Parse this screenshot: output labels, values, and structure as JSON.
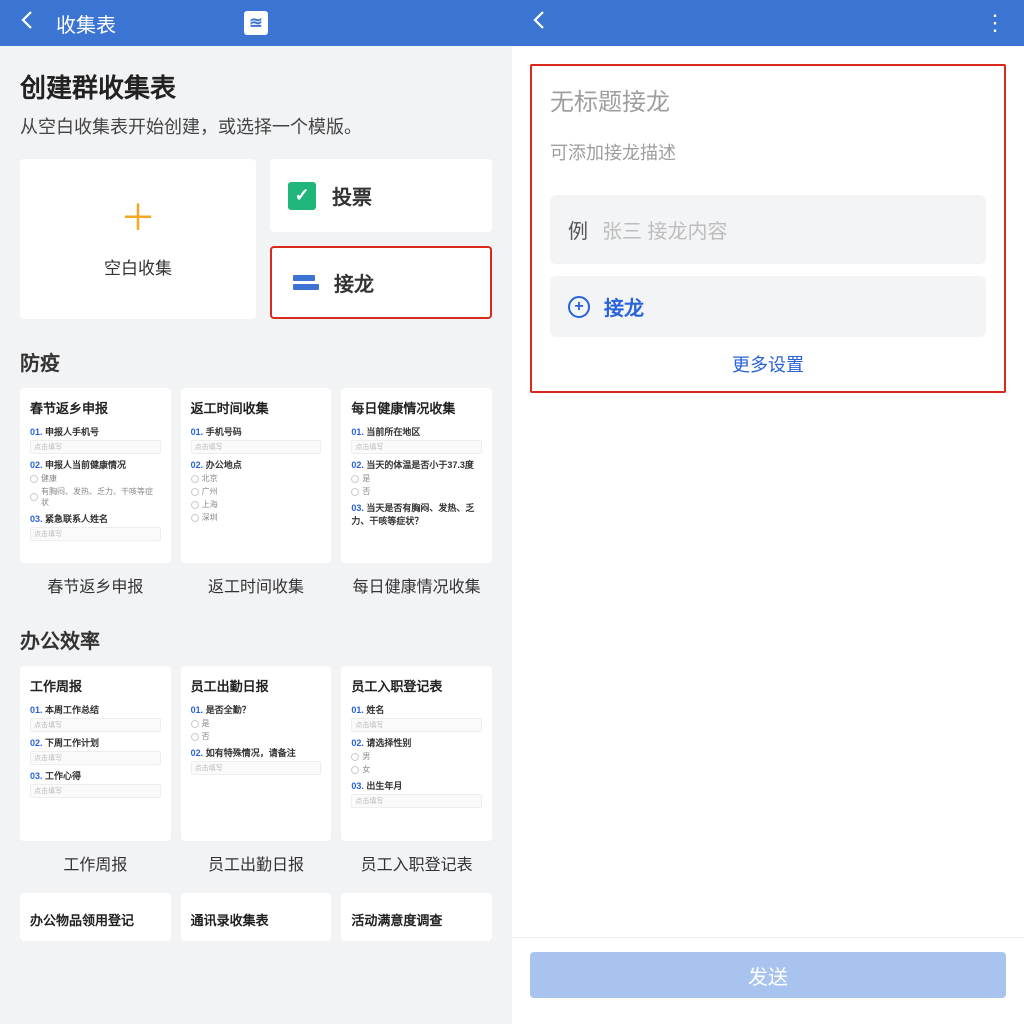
{
  "left": {
    "title": "收集表",
    "heading": "创建群收集表",
    "subheading": "从空白收集表开始创建，或选择一个模版。",
    "blank_label": "空白收集",
    "quick": {
      "vote": "投票",
      "chain": "接龙"
    },
    "sections": {
      "a_title": "防疫",
      "a": [
        {
          "name": "春节返乡申报",
          "fields": [
            {
              "n": "01.",
              "t": "申报人手机号",
              "input": true,
              "ph": "点击填写"
            },
            {
              "n": "02.",
              "t": "申报人当前健康情况",
              "opts": [
                "健康",
                "有胸闷、发热、乏力、干咳等症状"
              ]
            },
            {
              "n": "03.",
              "t": "紧急联系人姓名",
              "input": true,
              "ph": "点击填写"
            }
          ]
        },
        {
          "name": "返工时间收集",
          "fields": [
            {
              "n": "01.",
              "t": "手机号码",
              "input": true,
              "ph": "点击填写"
            },
            {
              "n": "02.",
              "t": "办公地点",
              "opts": [
                "北京",
                "广州",
                "上海",
                "深圳"
              ]
            }
          ]
        },
        {
          "name": "每日健康情况收集",
          "fields": [
            {
              "n": "01.",
              "t": "当前所在地区",
              "input": true,
              "ph": "点击填写"
            },
            {
              "n": "02.",
              "t": "当天的体温是否小于37.3度",
              "opts": [
                "是",
                "否"
              ]
            },
            {
              "n": "03.",
              "t": "当天是否有胸闷、发热、乏力、干咳等症状？",
              "opts": []
            }
          ]
        }
      ],
      "b_title": "办公效率",
      "b": [
        {
          "name": "工作周报",
          "fields": [
            {
              "n": "01.",
              "t": "本周工作总结",
              "input": true,
              "ph": "点击填写"
            },
            {
              "n": "02.",
              "t": "下周工作计划",
              "input": true,
              "ph": "点击填写"
            },
            {
              "n": "03.",
              "t": "工作心得",
              "input": true,
              "ph": "点击填写"
            }
          ]
        },
        {
          "name": "员工出勤日报",
          "fields": [
            {
              "n": "01.",
              "t": "是否全勤？",
              "opts": [
                "是",
                "否"
              ]
            },
            {
              "n": "02.",
              "t": "如有特殊情况，请备注",
              "input": true,
              "ph": "点击填写"
            }
          ]
        },
        {
          "name": "员工入职登记表",
          "fields": [
            {
              "n": "01.",
              "t": "姓名",
              "input": true,
              "ph": "点击填写"
            },
            {
              "n": "02.",
              "t": "请选择性别",
              "opts": [
                "男",
                "女"
              ]
            },
            {
              "n": "03.",
              "t": "出生年月",
              "input": true,
              "ph": "点击填写"
            }
          ]
        }
      ],
      "c": [
        "办公物品领用登记",
        "通讯录收集表",
        "活动满意度调查"
      ]
    }
  },
  "right": {
    "title": "无标题接龙",
    "desc": "可添加接龙描述",
    "example_tag": "例",
    "example_hint": "张三 接龙内容",
    "add_label": "接龙",
    "more": "更多设置",
    "send": "发送"
  }
}
